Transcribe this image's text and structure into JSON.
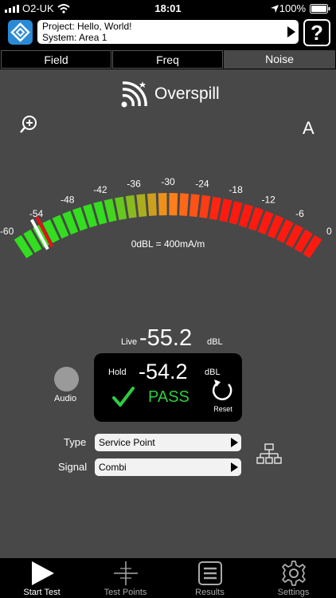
{
  "status_bar": {
    "carrier": "O2-UK",
    "time": "18:01",
    "battery": "100%"
  },
  "header": {
    "project_line": "Project: Hello, World!",
    "system_line": "System: Area 1",
    "help_label": "?"
  },
  "tabs": [
    {
      "label": "Field"
    },
    {
      "label": "Freq"
    },
    {
      "label": "Noise"
    }
  ],
  "mode": {
    "title": "Overspill",
    "channel": "A"
  },
  "meter": {
    "min": -60,
    "max": 0,
    "tick_labels": [
      "-60",
      "-54",
      "-48",
      "-42",
      "-36",
      "-30",
      "-24",
      "-18",
      "-12",
      "-6",
      "0"
    ],
    "reference_text": "0dBL = 400mA/m",
    "needle_value": -55.2,
    "hold_marker_value": -54.2,
    "segment_colors": {
      "green": "#33dd1f",
      "orange": "#ff8a1c",
      "red": "#ff1a10"
    }
  },
  "live": {
    "label": "Live",
    "value": "-55.2",
    "unit": "dBL"
  },
  "hold": {
    "label": "Hold",
    "value": "-54.2",
    "unit": "dBL",
    "result": "PASS",
    "reset_label": "Reset"
  },
  "audio": {
    "label": "Audio"
  },
  "type_row": {
    "label": "Type",
    "value": "Service Point"
  },
  "signal_row": {
    "label": "Signal",
    "value": "Combi"
  },
  "bottom_nav": [
    {
      "label": "Start Test",
      "icon": "play-icon"
    },
    {
      "label": "Test Points",
      "icon": "crosshair-icon"
    },
    {
      "label": "Results",
      "icon": "list-icon"
    },
    {
      "label": "Settings",
      "icon": "gear-icon"
    }
  ]
}
